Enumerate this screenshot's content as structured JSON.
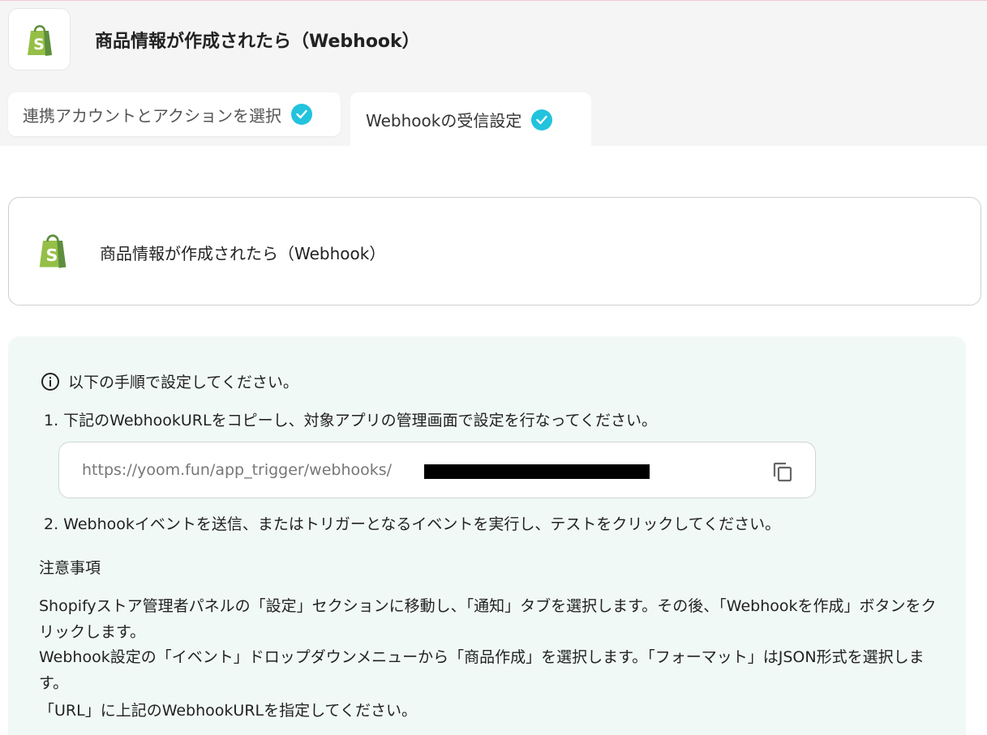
{
  "header": {
    "title": "商品情報が作成されたら（Webhook）",
    "app_icon": "shopify-icon"
  },
  "tabs": [
    {
      "label": "連携アカウントとアクションを選択",
      "completed": true
    },
    {
      "label": "Webhookの受信設定",
      "completed": true,
      "active": true
    }
  ],
  "trigger": {
    "label": "商品情報が作成されたら（Webhook）",
    "icon": "shopify-icon"
  },
  "instructions": {
    "heading": "以下の手順で設定してください。",
    "step1": "1. 下記のWebhookURLをコピーし、対象アプリの管理画面で設定を行なってください。",
    "webhook_url": "https://yoom.fun/app_trigger/webhooks/",
    "step2": "2. Webhookイベントを送信、またはトリガーとなるイベントを実行し、テストをクリックしてください。"
  },
  "notes": {
    "title": "注意事項",
    "line1": "Shopifyストア管理者パネルの「設定」セクションに移動し、「通知」タブを選択します。その後、「Webhookを作成」ボタンをクリックします。",
    "line2": "Webhook設定の「イベント」ドロップダウンメニューから「商品作成」を選択します。「フォーマット」はJSON形式を選択します。",
    "line3": "「URL」に上記のWebhookURLを指定してください。"
  },
  "colors": {
    "accent_check": "#22c3dd",
    "shopify_green": "#95bf47",
    "info_bg": "#f1f9f7"
  }
}
